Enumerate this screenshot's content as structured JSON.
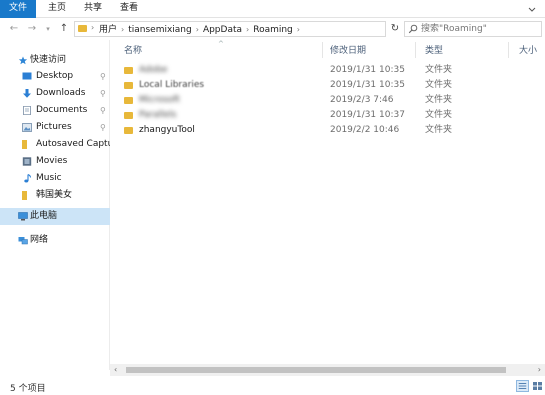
{
  "ribbon": {
    "tabs": [
      "文件",
      "主页",
      "共享",
      "查看"
    ]
  },
  "address": {
    "crumbs": [
      "用户",
      "tiansemixiang",
      "AppData",
      "Roaming"
    ],
    "search_placeholder": "搜索\"Roaming\""
  },
  "nav": {
    "quick_access": "快速访问",
    "items": [
      {
        "label": "Desktop",
        "icon": "desktop-icon",
        "pinned": true
      },
      {
        "label": "Downloads",
        "icon": "download-icon",
        "pinned": true
      },
      {
        "label": "Documents",
        "icon": "documents-icon",
        "pinned": true
      },
      {
        "label": "Pictures",
        "icon": "pictures-icon",
        "pinned": true
      },
      {
        "label": "Autosaved Captures",
        "icon": "folder-icon",
        "pinned": false
      },
      {
        "label": "Movies",
        "icon": "movies-icon",
        "pinned": false
      },
      {
        "label": "Music",
        "icon": "music-icon",
        "pinned": false
      },
      {
        "label": "韩国美女",
        "icon": "folder-icon",
        "pinned": false
      }
    ],
    "this_pc": "此电脑",
    "network": "网络",
    "pin_glyph": "📌"
  },
  "columns": {
    "name": "名称",
    "date": "修改日期",
    "type": "类型",
    "size": "大小"
  },
  "files": [
    {
      "name": "Adobe",
      "date": "2019/1/31 10:35",
      "type": "文件夹"
    },
    {
      "name": "Local Libraries",
      "date": "2019/1/31 10:35",
      "type": "文件夹"
    },
    {
      "name": "Microsoft",
      "date": "2019/2/3 7:46",
      "type": "文件夹"
    },
    {
      "name": "Parallels",
      "date": "2019/1/31 10:37",
      "type": "文件夹"
    },
    {
      "name": "zhangyuTool",
      "date": "2019/2/2 10:46",
      "type": "文件夹"
    }
  ],
  "status": {
    "count": "5 个项目"
  },
  "colors": {
    "accent": "#1979ca",
    "folder": "#e8b83a",
    "selection": "#cce4f7"
  }
}
